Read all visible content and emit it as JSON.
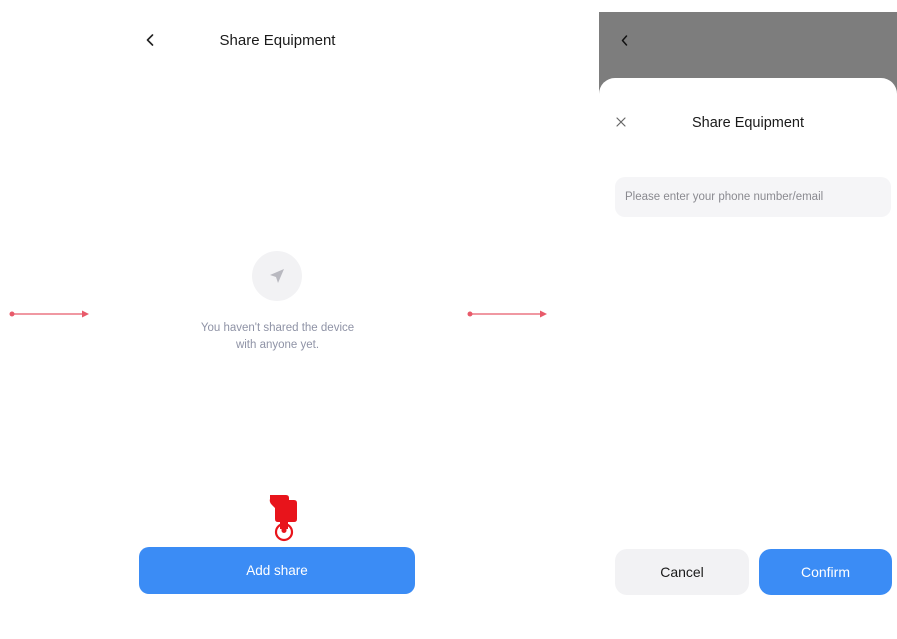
{
  "left_screen": {
    "title": "Share Equipment",
    "back_icon": "chevron-left-icon",
    "empty_state": {
      "icon": "paper-plane-icon",
      "line1": "You haven't shared the device",
      "line2": "with anyone yet."
    },
    "tap_indicator_icon": "tap-hand-icon",
    "add_share_label": "Add share"
  },
  "flow_arrows": {
    "icon": "arrow-right-icon",
    "color": "#e85a6a"
  },
  "right_screen": {
    "background_back_icon": "chevron-left-icon",
    "sheet": {
      "close_icon": "close-icon",
      "title": "Share Equipment",
      "input": {
        "placeholder": "Please enter your phone number/email",
        "value": ""
      },
      "cancel_label": "Cancel",
      "confirm_label": "Confirm"
    }
  },
  "colors": {
    "primary": "#3b8cf5",
    "overlay": "#7d7d7d",
    "muted_text": "#8f93a6",
    "tap_indicator": "#e8141b"
  }
}
